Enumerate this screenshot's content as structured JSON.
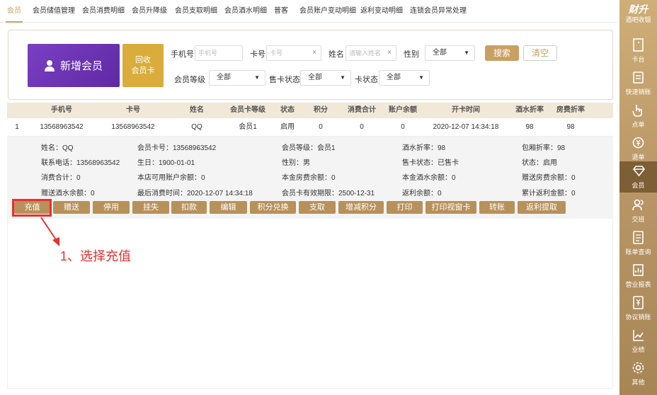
{
  "nav": {
    "tabs": [
      "会员",
      "会员储值管理",
      "会员消费明细",
      "会员升降级",
      "会员支取明细",
      "会员酒水明细",
      "普客",
      "会员账户变动明细",
      "返利变动明细",
      "连锁会员异常处理"
    ]
  },
  "toolbar": {
    "new_member": "新增会员",
    "recycle_line1": "回收",
    "recycle_line2": "会员卡",
    "search": "搜索",
    "clear": "清空"
  },
  "filters": {
    "phone_label": "手机号",
    "phone_placeholder": "手机号",
    "card_label": "卡号",
    "card_placeholder": "卡号",
    "name_label": "姓名",
    "name_placeholder": "请输入姓名",
    "gender_label": "性别",
    "gender_value": "全部",
    "level_label": "会员等级",
    "level_value": "全部",
    "sale_status_label": "售卡状态",
    "sale_status_value": "全部",
    "card_status_label": "卡状态",
    "card_status_value": "全部"
  },
  "table": {
    "headers": [
      "手机号",
      "卡号",
      "姓名",
      "会员卡等级",
      "状态",
      "积分",
      "消费合计",
      "账户余额",
      "开卡时间",
      "酒水折率",
      "房费折率"
    ],
    "row": [
      "1",
      "13568963542",
      "13568963542",
      "QQ",
      "会员1",
      "启用",
      "0",
      "0",
      "0",
      "2020-12-07 14:34:18",
      "98",
      "98"
    ]
  },
  "detail": [
    [
      "姓名：QQ",
      "会员卡号：13568963542",
      "会员等级：会员1",
      "酒水折率：98",
      "包厢折率：98"
    ],
    [
      "联系电话：13568963542",
      "生日：1900-01-01",
      "性别：男",
      "售卡状态：已售卡",
      "状态：启用"
    ],
    [
      "消费合计：0",
      "本店可用账户余额：0",
      "本金房费余额：0",
      "本金酒水余额：0",
      "赠送房费余额：0"
    ],
    [
      "赠送酒水余额：0",
      "最后消费时间：2020-12-07 14:34:18",
      "会员卡有效期限：2500-12-31",
      "返利余额：0",
      "累计返利金额：0"
    ]
  ],
  "actions": [
    "充值",
    "赠送",
    "停用",
    "挂失",
    "扣款",
    "编辑",
    "积分兑换",
    "支取",
    "增减积分",
    "打印",
    "打印视窗卡",
    "转账",
    "返利提取"
  ],
  "annotation": "1、选择充值",
  "sidebar": {
    "brand": "财升",
    "brand_sub": "酒吧收银",
    "items": [
      "卡台",
      "快速销账",
      "点单",
      "退单",
      "会员",
      "交班",
      "账单查询",
      "营业报表",
      "协议销账",
      "业绩",
      "其他"
    ]
  },
  "colors": {
    "accent": "#c9a063",
    "purple": "#6a35b3",
    "gold": "#d9ac3b",
    "action": "#b8915a",
    "annotation": "#e8312f"
  }
}
